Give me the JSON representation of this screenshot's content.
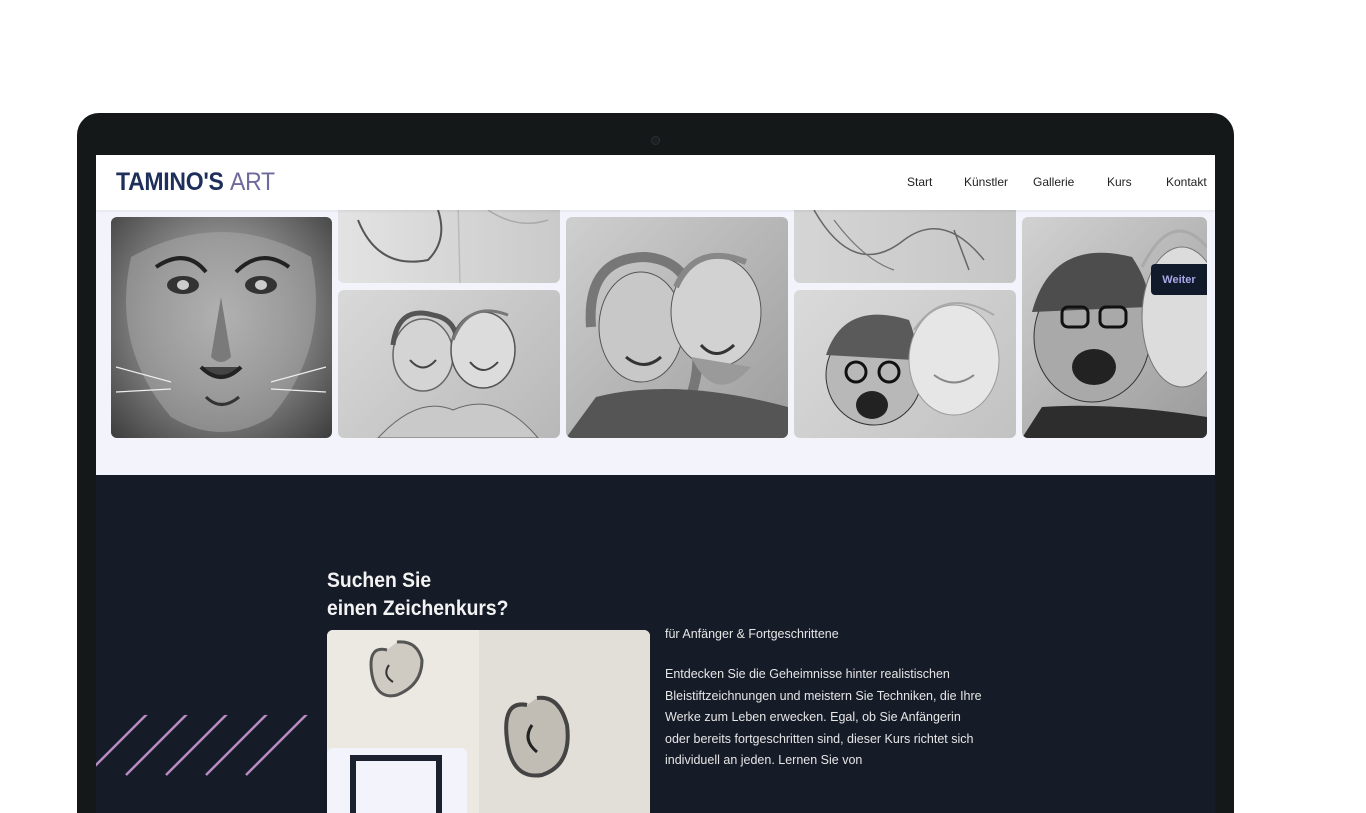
{
  "site": {
    "logo_main": "TAMINO'S",
    "logo_accent": "ART"
  },
  "nav": {
    "items": [
      {
        "label": "Start"
      },
      {
        "label": "Künstler"
      },
      {
        "label": "Gallerie"
      },
      {
        "label": "Kurs"
      },
      {
        "label": "Kontakt"
      }
    ]
  },
  "gallery": {
    "next_button": "Weiter",
    "images": [
      {
        "subject": "lion pencil drawing"
      },
      {
        "subject": "portrait sketch (partial)"
      },
      {
        "subject": "couple portrait sketch"
      },
      {
        "subject": "couple portrait pencil drawing"
      },
      {
        "subject": "line sketch (partial)"
      },
      {
        "subject": "two people in beanies sketch"
      },
      {
        "subject": "two people in beanies drawing"
      }
    ]
  },
  "course": {
    "title_line1": "Suchen Sie",
    "title_line2": "einen Zeichenkurs?",
    "subtitle": "für Anfänger & Fortgeschrittene",
    "description": "Entdecken Sie die Geheimnisse hinter realistischen Bleistiftzeichnungen und meistern Sie Techniken, die Ihre Werke zum Leben erwecken. Egal, ob Sie Anfängerin oder bereits fortgeschritten sind, dieser Kurs richtet sich individuell an jeden. Lernen Sie von",
    "image_subject": "ear pencil drawings"
  },
  "colors": {
    "logo_main": "#1f2f5b",
    "logo_accent": "#6f6a9e",
    "dark_section": "#161b28",
    "button_bg": "#111a2b",
    "button_text": "#a9a7e8",
    "stripe": "#b88bc2"
  }
}
